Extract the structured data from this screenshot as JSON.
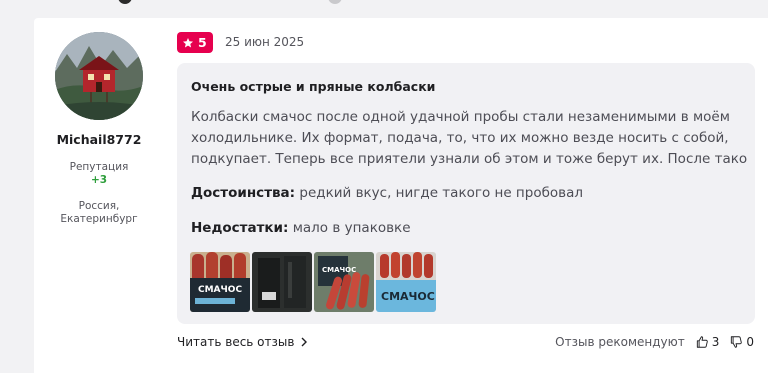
{
  "review": {
    "author": {
      "username": "Michail8772",
      "reputation_label": "Репутация",
      "reputation_value": "+3",
      "location_country": "Россия,",
      "location_city": "Екатеринбург"
    },
    "rating": "5",
    "date": "25 июн 2025",
    "title": "Очень острые и пряные колбаски",
    "text_lines": [
      "Колбаски смачос после одной удачной пробы стали незаменимыми в моём",
      "холодильнике. Их формат, подача, то, что их можно везде носить с собой,",
      "подкупает. Теперь все приятели узнали об этом и тоже берут их. После такого..."
    ],
    "pros_label": "Достоинства:",
    "pros_text": "редкий вкус, нигде такого не пробовал",
    "cons_label": "Недостатки:",
    "cons_text": "мало в упаковке",
    "photos": [
      {
        "name": "photo-1",
        "label": "СМАЧОС"
      },
      {
        "name": "photo-2",
        "label": ""
      },
      {
        "name": "photo-3",
        "label": "СМАЧОС"
      },
      {
        "name": "photo-4",
        "label": "СМАЧОС"
      }
    ]
  },
  "footer": {
    "read_full": "Читать весь отзыв",
    "read_full_icon": "chevron-right-icon",
    "recommend_label": "Отзыв рекомендуют",
    "likes": "3",
    "dislikes": "0"
  },
  "colors": {
    "accent": "#e6004e",
    "positive": "#2e9e3b",
    "review_bg": "#f1f1f4"
  }
}
